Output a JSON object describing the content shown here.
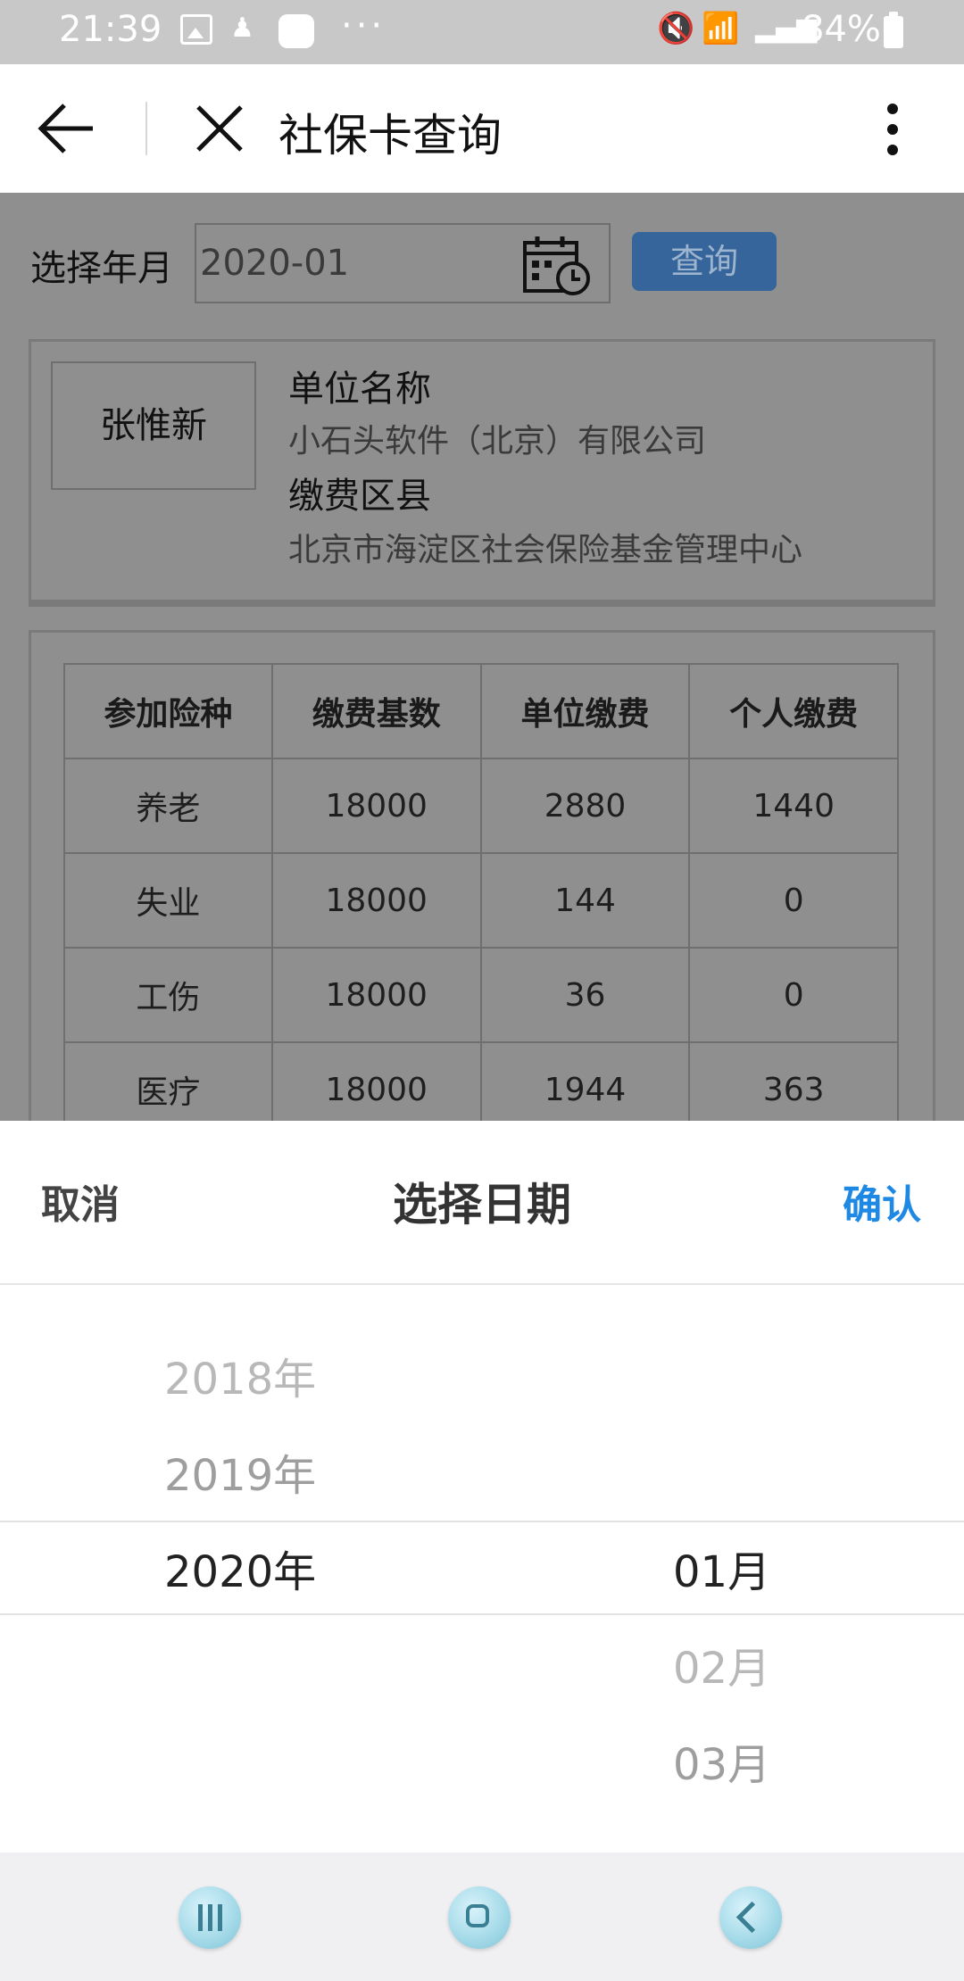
{
  "status_bar": {
    "time": "21:39",
    "more": "···",
    "battery": "84%"
  },
  "title_bar": {
    "title": "社保卡查询"
  },
  "query": {
    "label": "选择年月",
    "value": "2020-01",
    "button_label": "查询"
  },
  "info": {
    "name": "张惟新",
    "company_label": "单位名称",
    "company_value": "小石头软件（北京）有限公司",
    "district_label": "缴费区县",
    "district_value": "北京市海淀区社会保险基金管理中心"
  },
  "table": {
    "headers": [
      "参加险种",
      "缴费基数",
      "单位缴费",
      "个人缴费"
    ],
    "rows": [
      [
        "养老",
        "18000",
        "2880",
        "1440"
      ],
      [
        "失业",
        "18000",
        "144",
        "0"
      ],
      [
        "工伤",
        "18000",
        "36",
        "0"
      ],
      [
        "医疗",
        "18000",
        "1944",
        "363"
      ]
    ]
  },
  "picker": {
    "cancel": "取消",
    "title": "选择日期",
    "confirm": "确认",
    "years": [
      "2018年",
      "2019年",
      "2020年"
    ],
    "months": [
      "01月",
      "02月",
      "03月"
    ]
  },
  "icons": {
    "back": "arrow-left-icon",
    "close": "close-icon",
    "more": "more-vertical-icon",
    "calendar": "calendar-clock-icon"
  },
  "colors": {
    "overlay": "#8f8f8f",
    "query_button": "#35659a",
    "confirm": "#1e88e5"
  }
}
